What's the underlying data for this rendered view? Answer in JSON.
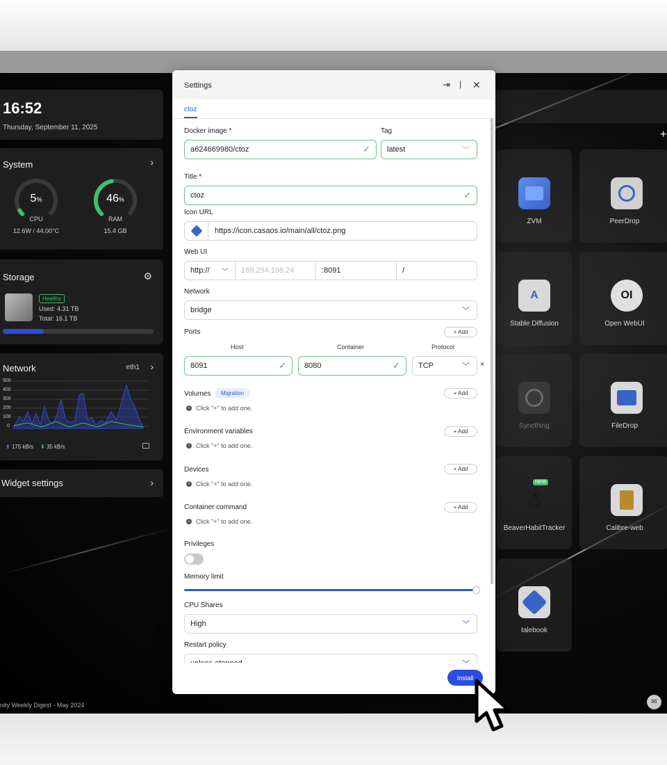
{
  "clock": {
    "time": "16:52",
    "date": "Thursday, September 11, 2025"
  },
  "system": {
    "title": "System",
    "cpu": {
      "value": "5",
      "unit": "%",
      "label": "CPU",
      "detail": "12.6W / 44.00°C",
      "fraction": 0.05,
      "color": "#3fbf6a"
    },
    "ram": {
      "value": "46",
      "unit": "%",
      "label": "RAM",
      "detail": "15.4 GB",
      "fraction": 0.46,
      "color": "#3fbf6a"
    }
  },
  "storage": {
    "title": "Storage",
    "status": "Healthy",
    "used": "Used: 4.31 TB",
    "total": "Total: 16.1 TB",
    "usage_fraction": 0.27
  },
  "network": {
    "title": "Network",
    "interface": "eth1",
    "y_ticks": [
      "500",
      "400",
      "300",
      "200",
      "100",
      "0"
    ],
    "upload": "175 kB/s",
    "download": "35 kB/s"
  },
  "widget_settings": {
    "label": "Widget settings"
  },
  "footer_text": "nity Weekly Digest - May 2024",
  "apps": [
    {
      "name": "ZVM",
      "icon": "zvm-icon"
    },
    {
      "name": "PeerDrop",
      "icon": "peerdrop-icon"
    },
    {
      "name": "Stable Diffusion",
      "icon": "stable-diffusion-icon"
    },
    {
      "name": "Open WebUI",
      "icon": "open-webui-icon",
      "glyph": "OI"
    },
    {
      "name": "Syncthing",
      "icon": "syncthing-icon"
    },
    {
      "name": "FileDrop",
      "icon": "filedrop-icon"
    },
    {
      "name": "BeaverHabitTracker",
      "icon": "beaver-icon",
      "badge": "NEW"
    },
    {
      "name": "Calibre-web",
      "icon": "calibre-icon"
    },
    {
      "name": "talebook",
      "icon": "talebook-icon"
    }
  ],
  "settings": {
    "title": "Settings",
    "tab": "ctoz",
    "docker_image": {
      "label": "Docker image *",
      "value": "a624669980/ctoz"
    },
    "tag": {
      "label": "Tag",
      "value": "latest"
    },
    "title_field": {
      "label": "Title *",
      "value": "ctoz"
    },
    "icon_url": {
      "label": "Icon URL",
      "value": "https://icon.casaos.io/main/all/ctoz.png"
    },
    "web_ui": {
      "label": "Web UI",
      "scheme": "http://",
      "host_placeholder": "169.254.198.24",
      "port": ":8091",
      "path": "/"
    },
    "network": {
      "label": "Network",
      "value": "bridge"
    },
    "ports": {
      "label": "Ports",
      "add": "+ Add",
      "col_host": "Host",
      "col_container": "Container",
      "col_protocol": "Protocol",
      "host": "8091",
      "container": "8080",
      "protocol": "TCP",
      "remove": "×"
    },
    "volumes": {
      "label": "Volumes",
      "badge": "Migration",
      "add": "+ Add",
      "hint": "Click \"+\" to add one."
    },
    "env": {
      "label": "Environment variables",
      "add": "+ Add",
      "hint": "Click \"+\" to add one."
    },
    "devices": {
      "label": "Devices",
      "add": "+ Add",
      "hint": "Click \"+\" to add one."
    },
    "command": {
      "label": "Container command",
      "add": "+ Add",
      "hint": "Click \"+\" to add one."
    },
    "privileges": {
      "label": "Privileges",
      "enabled": false
    },
    "memory": {
      "label": "Memory limit",
      "fraction": 1.0
    },
    "cpu_shares": {
      "label": "CPU Shares",
      "value": "High"
    },
    "restart": {
      "label": "Restart policy",
      "value": "unless-stopped"
    },
    "install": "Install"
  }
}
